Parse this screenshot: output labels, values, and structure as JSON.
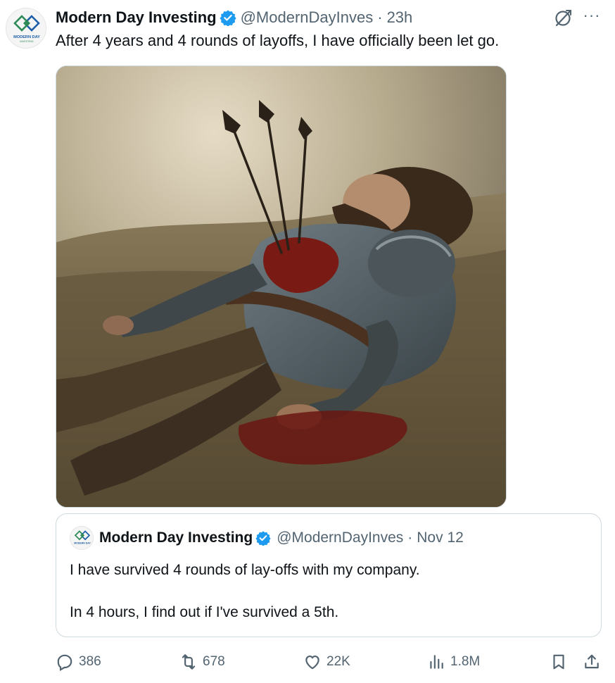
{
  "post": {
    "author_name": "Modern Day Investing",
    "handle": "@ModernDayInves",
    "separator": "·",
    "time": "23h",
    "text": "After 4 years and 4 rounds of layoffs, I have officially been let go.",
    "avatar_logo_text": "MODERN DAY",
    "avatar_logo_subtext": "INVESTING",
    "more_label": "···"
  },
  "quote": {
    "author_name": "Modern Day Investing",
    "handle": "@ModernDayInves",
    "separator": "·",
    "time": "Nov 12",
    "line1": "I have survived 4 rounds of lay-offs with my company.",
    "line2": "In 4 hours, I find out if I've survived a 5th."
  },
  "actions": {
    "replies": "386",
    "reposts": "678",
    "likes": "22K",
    "views": "1.8M"
  },
  "icons": {
    "verified": "verified-badge-icon",
    "grok": "grok-icon",
    "more": "more-icon",
    "reply": "reply-icon",
    "repost": "repost-icon",
    "like": "heart-icon",
    "views": "views-icon",
    "bookmark": "bookmark-icon",
    "share": "share-icon"
  },
  "colors": {
    "verified": "#1d9bf0",
    "text": "#0f1419",
    "secondary": "#536471",
    "border": "#cfd9de",
    "logo_green": "#2e8b57",
    "logo_blue": "#1f5fa8"
  }
}
